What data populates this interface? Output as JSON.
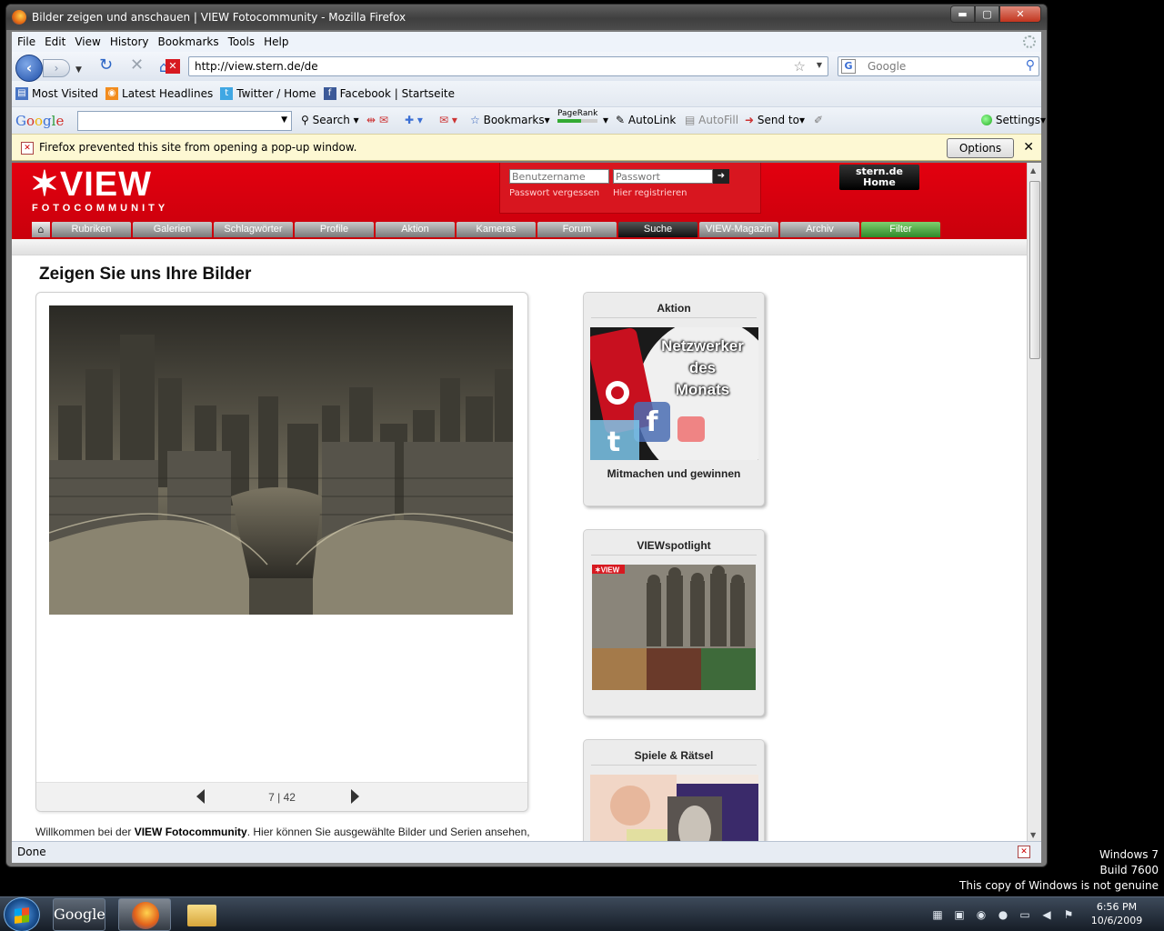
{
  "window": {
    "title": "Bilder zeigen und anschauen | VIEW Fotocommunity - Mozilla Firefox",
    "buttons": {
      "minimize": "▬",
      "maximize": "▢",
      "close": "✕"
    }
  },
  "menu": [
    "File",
    "Edit",
    "View",
    "History",
    "Bookmarks",
    "Tools",
    "Help"
  ],
  "nav": {
    "url": "http://view.stern.de/de",
    "search_placeholder": "Google",
    "search_engine_icon": "G"
  },
  "bookmarks": [
    {
      "label": "Most Visited",
      "icon": "most-visited-icon",
      "color": "#4a76c4"
    },
    {
      "label": "Latest Headlines",
      "icon": "rss-icon",
      "color": "#f28c1e"
    },
    {
      "label": "Twitter / Home",
      "icon": "twitter-icon",
      "color": "#40a7e3"
    },
    {
      "label": "Facebook | Startseite",
      "icon": "facebook-icon",
      "color": "#3b5998"
    }
  ],
  "google_toolbar": {
    "logo": "Google",
    "search_label": "Search",
    "bookmarks_label": "Bookmarks",
    "pagerank_label": "PageRank",
    "autolink_label": "AutoLink",
    "autofill_label": "AutoFill",
    "sendto_label": "Send to",
    "settings_label": "Settings"
  },
  "notification": {
    "message": "Firefox prevented this site from opening a pop-up window.",
    "options_label": "Options",
    "close_label": "✕"
  },
  "site": {
    "logo": "VIEW",
    "logo_sub": "FOTOCOMMUNITY",
    "username_placeholder": "Benutzername",
    "password_placeholder": "Passwort",
    "forgot_password": "Passwort vergessen",
    "register": "Hier registrieren",
    "stern_home_line1": "stern.de",
    "stern_home_line2": "Home",
    "nav_tabs": [
      "Rubriken",
      "Galerien",
      "Schlagwörter",
      "Profile",
      "Aktion",
      "Kameras",
      "Forum",
      "Suche",
      "VIEW-Magazin",
      "Archiv",
      "Filter"
    ],
    "active_tab": "Suche"
  },
  "content": {
    "page_title": "Zeigen Sie uns Ihre Bilder",
    "pager_current": "7",
    "pager_total": "42",
    "welcome_text_before": "Willkommen bei der ",
    "welcome_brand": "VIEW Fotocommunity",
    "welcome_text_after": ". Hier können Sie ausgewählte Bilder und Serien ansehen,"
  },
  "sidebar": {
    "aktion": {
      "title": "Aktion",
      "banner_line1": "Netzwerker",
      "banner_line2": "des",
      "banner_line3": "Monats",
      "caption": "Mitmachen und gewinnen"
    },
    "spotlight": {
      "title": "VIEWspotlight",
      "mini_logo": "VIEW"
    },
    "spiele": {
      "title": "Spiele & Rätsel"
    }
  },
  "status": {
    "text": "Done"
  },
  "desktop": {
    "watermark_line1": "Windows 7",
    "watermark_line2": "Build 7600",
    "watermark_line3": "This copy of Windows is not genuine"
  },
  "taskbar": {
    "google_label": "Google",
    "clock_time": "6:56 PM",
    "clock_date": "10/6/2009"
  }
}
